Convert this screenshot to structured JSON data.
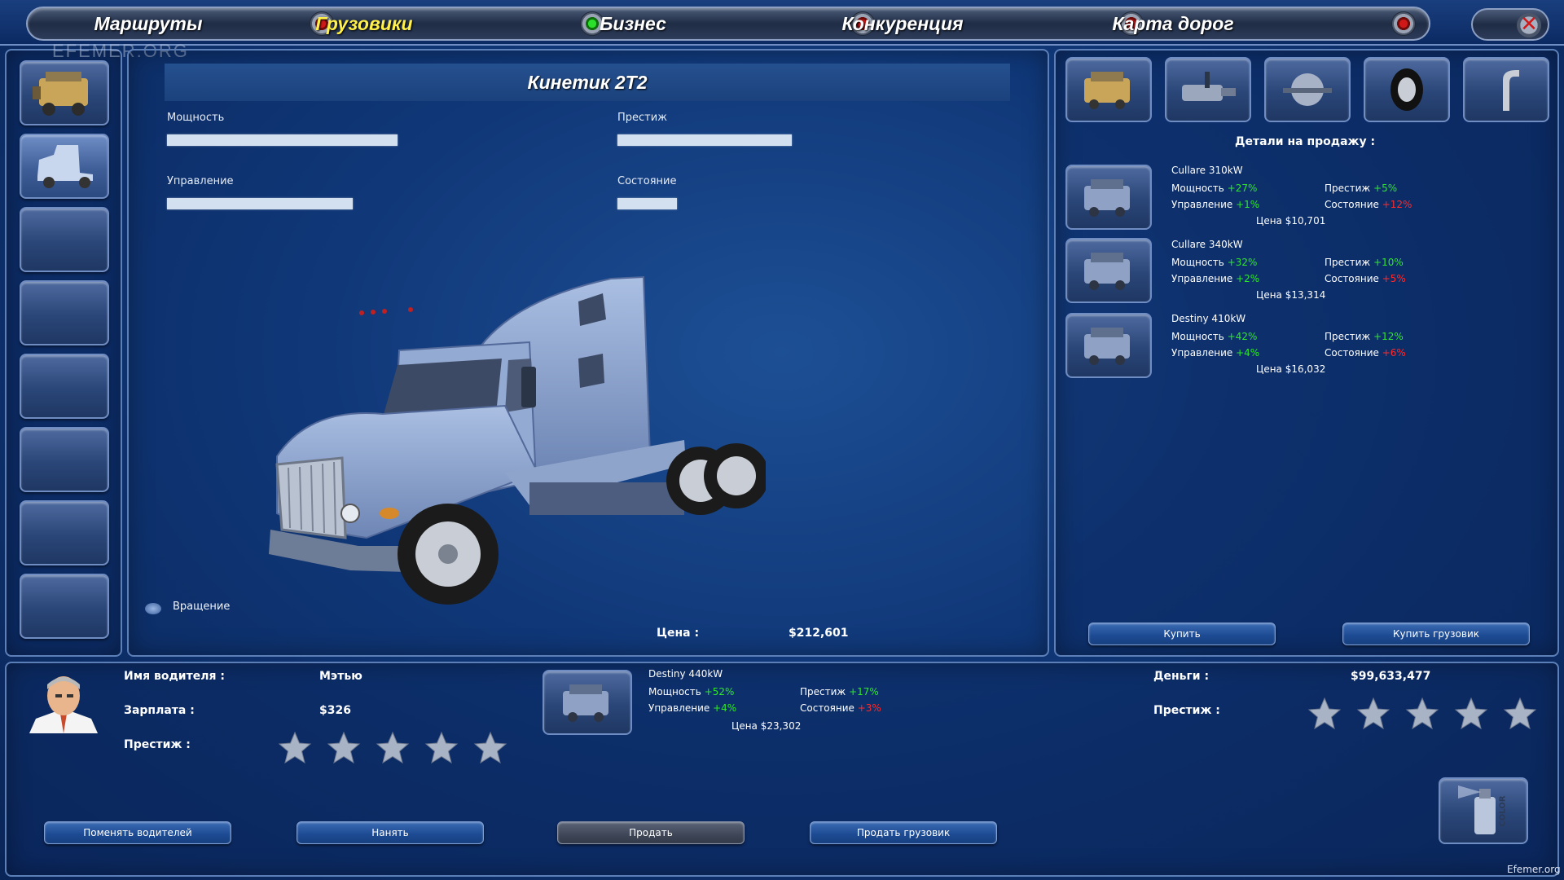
{
  "nav": {
    "tabs": [
      "Маршруты",
      "Грузовики",
      "Бизнес",
      "Конкуренция",
      "Карта дорог"
    ],
    "active": 1
  },
  "watermark": "EFEMER.ORG",
  "truck": {
    "name": "Кинетик 2Т2",
    "stats": {
      "power": {
        "label": "Мощность",
        "level": 0.62
      },
      "prestige": {
        "label": "Престиж",
        "level": 0.47
      },
      "handling": {
        "label": "Управление",
        "level": 0.5
      },
      "condition": {
        "label": "Состояние",
        "level": 0.16
      }
    },
    "rotation_label": "Вращение",
    "price_label": "Цена :",
    "price_value": "$212,601",
    "color": "#8ea6cf"
  },
  "parts_panel": {
    "title": "Детали на продажу :",
    "categories": [
      "engine-icon",
      "transmission-icon",
      "chassis-icon",
      "wheel-icon",
      "exhaust-icon"
    ],
    "items": [
      {
        "name": "Cullare 310kW",
        "power_label": "Мощность",
        "power": "+27%",
        "handling_label": "Управление",
        "handling": "+1%",
        "prestige_label": "Престиж",
        "prestige": "+5%",
        "condition_label": "Состояние",
        "condition": "+12%",
        "price": "Цена $10,701"
      },
      {
        "name": "Cullare 340kW",
        "power_label": "Мощность",
        "power": "+32%",
        "handling_label": "Управление",
        "handling": "+2%",
        "prestige_label": "Престиж",
        "prestige": "+10%",
        "condition_label": "Состояние",
        "condition": "+5%",
        "price": "Цена $13,314"
      },
      {
        "name": "Destiny 410kW",
        "power_label": "Мощность",
        "power": "+42%",
        "handling_label": "Управление",
        "handling": "+4%",
        "prestige_label": "Престиж",
        "prestige": "+12%",
        "condition_label": "Состояние",
        "condition": "+6%",
        "price": "Цена $16,032"
      }
    ],
    "buy_label": "Купить",
    "buy_truck_label": "Купить грузовик"
  },
  "driver": {
    "name_label": "Имя водителя :",
    "name": "Мэтью",
    "salary_label": "Зарплата :",
    "salary": "$326",
    "prestige_label": "Престиж :",
    "prestige_stars": 0
  },
  "installed_part": {
    "name": "Destiny 440kW",
    "power_label": "Мощность",
    "power": "+52%",
    "handling_label": "Управление",
    "handling": "+4%",
    "prestige_label": "Престиж",
    "prestige": "+17%",
    "condition_label": "Состояние",
    "condition": "+3%",
    "price": "Цена $23,302"
  },
  "company": {
    "money_label": "Деньги :",
    "money": "$99,633,477",
    "prestige_label": "Престиж :",
    "prestige_stars": 0
  },
  "buttons": {
    "change_drivers": "Поменять водителей",
    "hire": "Нанять",
    "sell": "Продать",
    "sell_truck": "Продать грузовик"
  },
  "paint_label": "COLOR",
  "footer_mark": "Efemer.org"
}
